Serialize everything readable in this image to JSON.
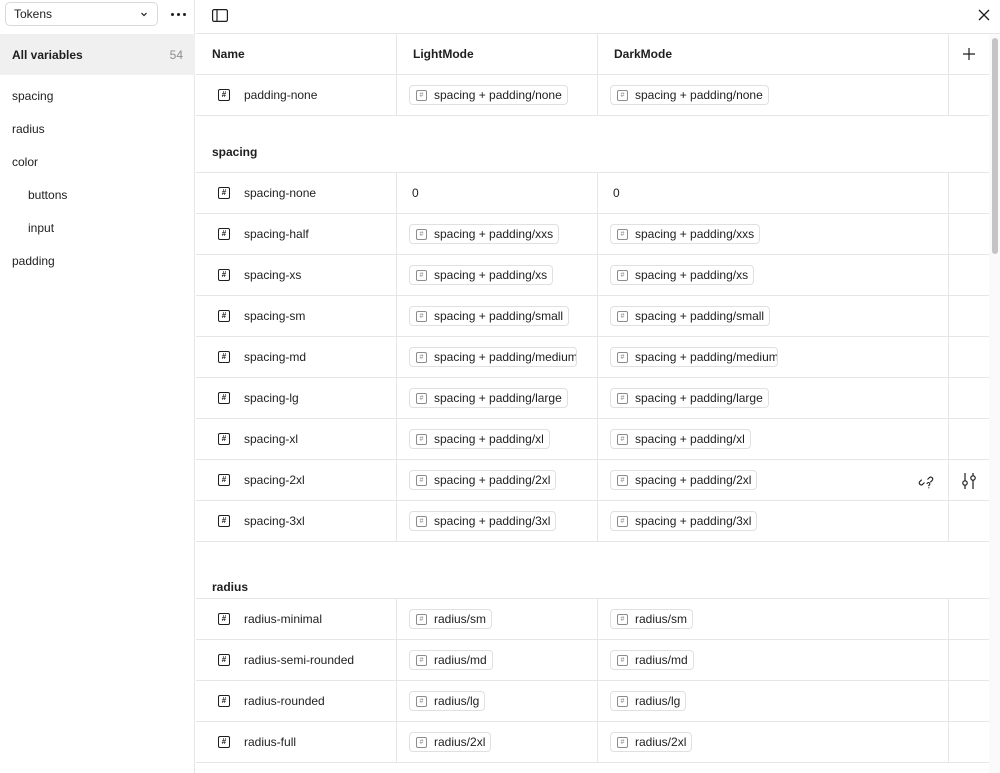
{
  "sidebar": {
    "collection": "Tokens",
    "all_variables": {
      "label": "All variables",
      "count": "54"
    },
    "groups": [
      {
        "label": "spacing",
        "level": 0
      },
      {
        "label": "radius",
        "level": 0
      },
      {
        "label": "color",
        "level": 0
      },
      {
        "label": "buttons",
        "level": 1
      },
      {
        "label": "input",
        "level": 1
      },
      {
        "label": "padding",
        "level": 0
      }
    ]
  },
  "table": {
    "headers": {
      "name": "Name",
      "mode1": "LightMode",
      "mode2": "DarkMode"
    },
    "top_rows": [
      {
        "name": "padding-none",
        "light": "spacing + padding/none",
        "dark": "spacing + padding/none"
      }
    ],
    "sections": [
      {
        "title": "spacing",
        "rows": [
          {
            "name": "spacing-none",
            "light": "0",
            "dark": "0",
            "raw": true
          },
          {
            "name": "spacing-half",
            "light": "spacing + padding/xxs",
            "dark": "spacing + padding/xxs"
          },
          {
            "name": "spacing-xs",
            "light": "spacing + padding/xs",
            "dark": "spacing + padding/xs"
          },
          {
            "name": "spacing-sm",
            "light": "spacing + padding/small",
            "dark": "spacing + padding/small"
          },
          {
            "name": "spacing-md",
            "light": "spacing + padding/medium",
            "dark": "spacing + padding/medium"
          },
          {
            "name": "spacing-lg",
            "light": "spacing + padding/large",
            "dark": "spacing + padding/large"
          },
          {
            "name": "spacing-xl",
            "light": "spacing + padding/xl",
            "dark": "spacing + padding/xl"
          },
          {
            "name": "spacing-2xl",
            "light": "spacing + padding/2xl",
            "dark": "spacing + padding/2xl"
          },
          {
            "name": "spacing-3xl",
            "light": "spacing + padding/3xl",
            "dark": "spacing + padding/3xl"
          }
        ]
      },
      {
        "title": "radius",
        "rows": [
          {
            "name": "radius-minimal",
            "light": "radius/sm",
            "dark": "radius/sm"
          },
          {
            "name": "radius-semi-rounded",
            "light": "radius/md",
            "dark": "radius/md"
          },
          {
            "name": "radius-rounded",
            "light": "radius/lg",
            "dark": "radius/lg"
          },
          {
            "name": "radius-full",
            "light": "radius/2xl",
            "dark": "radius/2xl"
          }
        ]
      }
    ]
  },
  "icons": {
    "variable": "number-variable-icon",
    "alias": "alias-variable-icon",
    "panel": "sidebar-toggle-icon",
    "close": "close-icon",
    "add": "plus-icon",
    "detach": "unlink-icon",
    "edit": "edit-variable-icon"
  }
}
